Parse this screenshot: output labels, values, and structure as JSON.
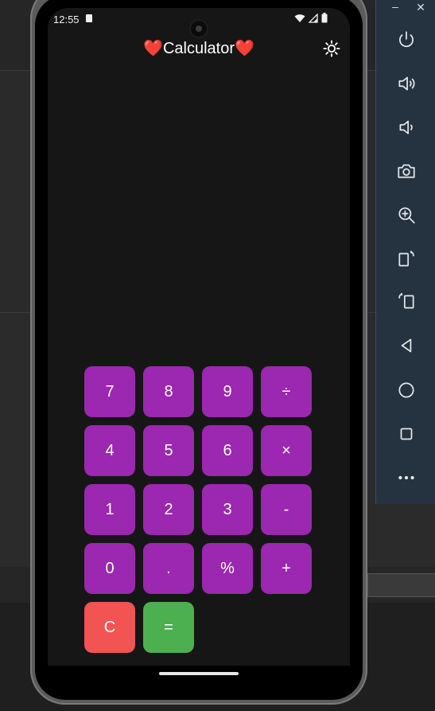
{
  "window": {
    "minimize_glyph": "–",
    "close_glyph": "✕"
  },
  "emulator_toolbar": [
    {
      "name": "power-icon"
    },
    {
      "name": "volume-up-icon"
    },
    {
      "name": "volume-down-icon"
    },
    {
      "name": "camera-icon"
    },
    {
      "name": "zoom-icon"
    },
    {
      "name": "rotate-left-icon"
    },
    {
      "name": "rotate-right-icon"
    },
    {
      "name": "back-icon"
    },
    {
      "name": "home-icon"
    },
    {
      "name": "overview-icon"
    },
    {
      "name": "more-icon"
    }
  ],
  "status_bar": {
    "time": "12:55"
  },
  "app": {
    "heart_left": "❤️",
    "title": "Calculator",
    "heart_right": "❤️",
    "theme_icon": "sun-icon"
  },
  "keypad": {
    "keys": [
      "7",
      "8",
      "9",
      "÷",
      "4",
      "5",
      "6",
      "×",
      "1",
      "2",
      "3",
      "-",
      "0",
      ".",
      "%",
      "+",
      "C",
      "="
    ]
  },
  "colors": {
    "key": "#9c27b0",
    "clear": "#f25454",
    "equals": "#4caf50",
    "screen_bg": "#161616"
  }
}
